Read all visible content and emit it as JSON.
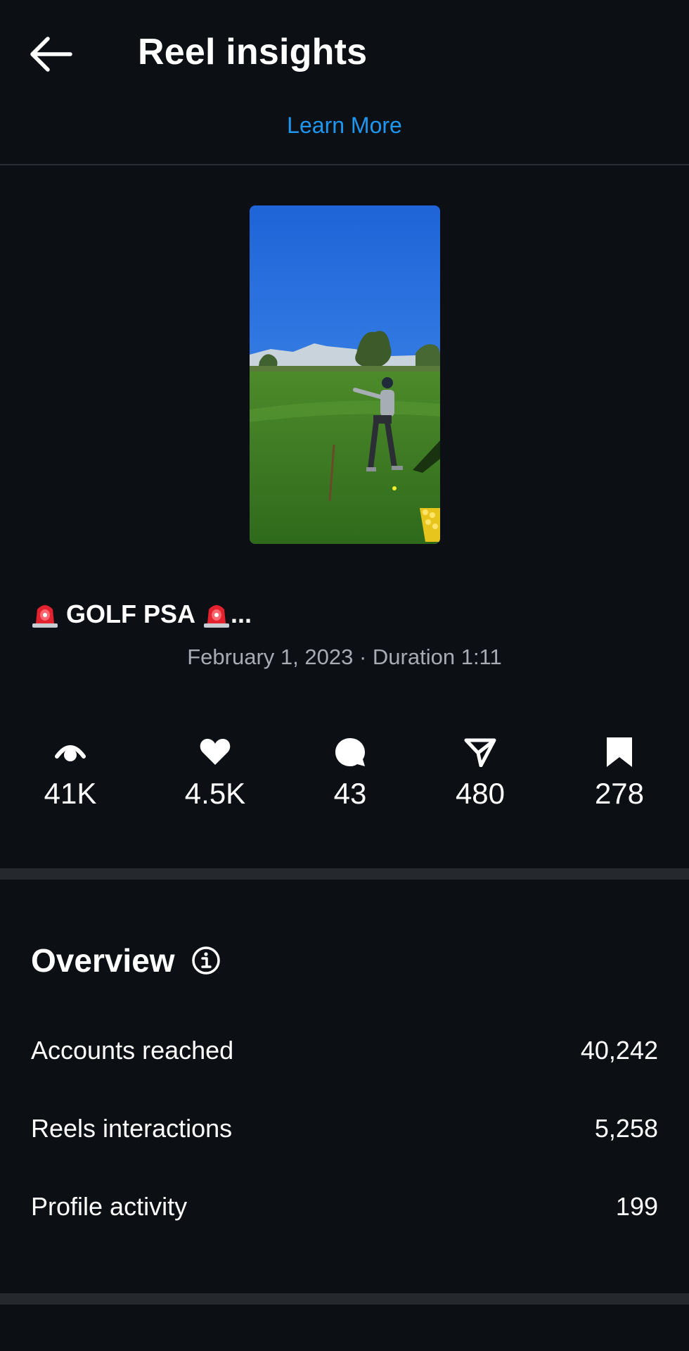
{
  "header": {
    "title": "Reel insights",
    "learn_more": "Learn More"
  },
  "reel": {
    "caption": "GOLF PSA",
    "caption_ellipsis": "...",
    "date": "February 1, 2023",
    "separator": "·",
    "duration": "Duration 1:11"
  },
  "stats": [
    {
      "icon": "views-icon",
      "value": "41K"
    },
    {
      "icon": "heart-icon",
      "value": "4.5K"
    },
    {
      "icon": "comment-icon",
      "value": "43"
    },
    {
      "icon": "share-icon",
      "value": "480"
    },
    {
      "icon": "bookmark-icon",
      "value": "278"
    }
  ],
  "overview": {
    "title": "Overview",
    "rows": [
      {
        "label": "Accounts reached",
        "value": "40,242"
      },
      {
        "label": "Reels interactions",
        "value": "5,258"
      },
      {
        "label": "Profile activity",
        "value": "199"
      }
    ]
  },
  "colors": {
    "background": "#0c0f14",
    "accent": "#1d97f0",
    "muted": "#a8abb1",
    "divider": "#25282d"
  }
}
